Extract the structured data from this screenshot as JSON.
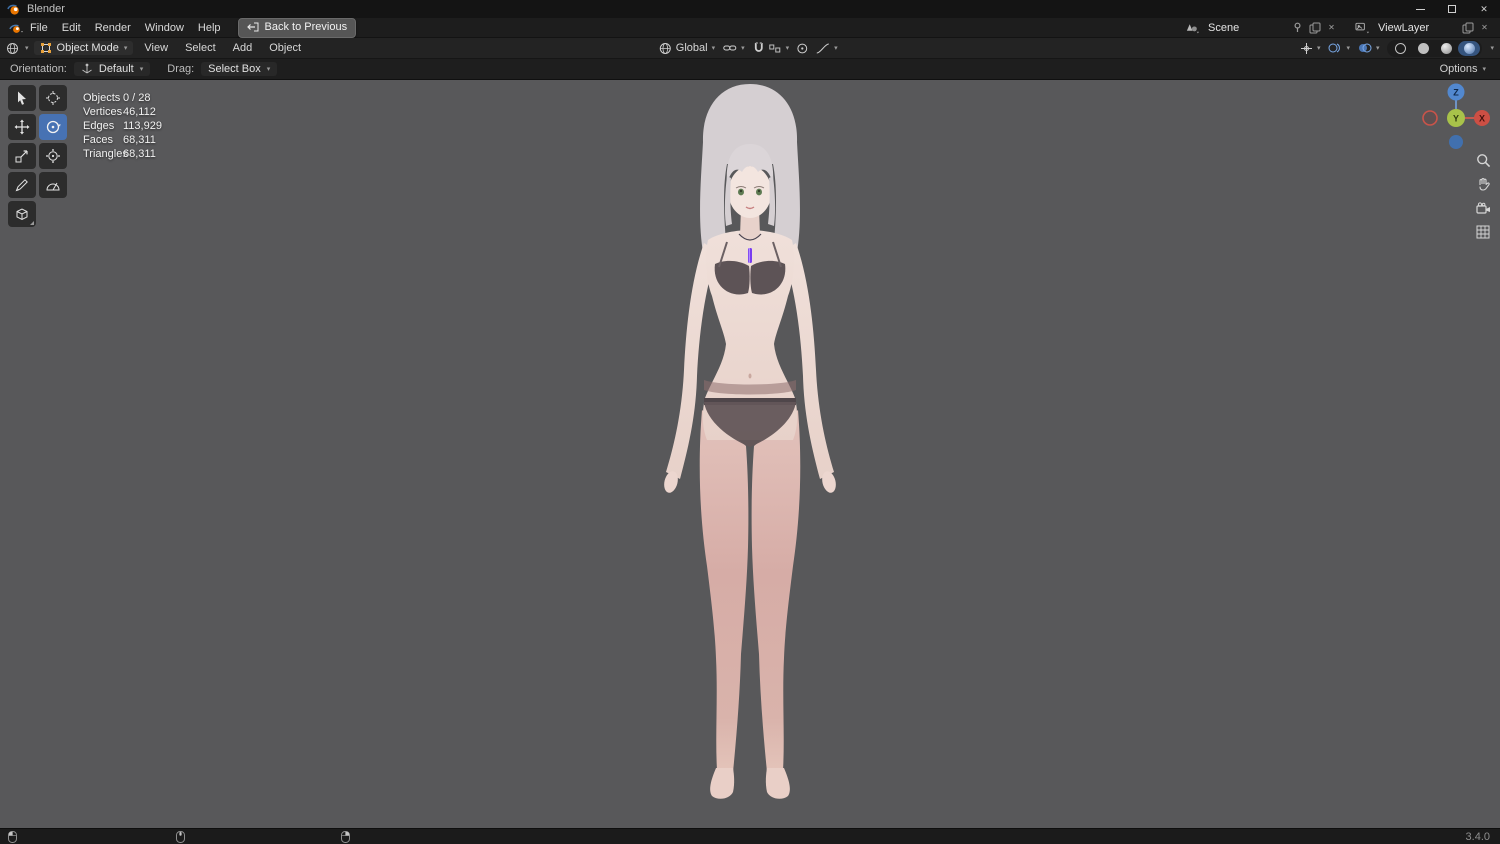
{
  "window": {
    "title": "Blender"
  },
  "topbar": {
    "menus": [
      "File",
      "Edit",
      "Render",
      "Window",
      "Help"
    ],
    "back_button": "Back to Previous",
    "scene": {
      "value": "Scene"
    },
    "view_layer": {
      "value": "ViewLayer"
    }
  },
  "viewport_header": {
    "mode": "Object Mode",
    "menus": [
      "View",
      "Select",
      "Add",
      "Object"
    ],
    "orientation": "Global",
    "options": "Options"
  },
  "tool_settings": {
    "orientation_label": "Orientation:",
    "orientation_value": "Default",
    "drag_label": "Drag:",
    "drag_value": "Select Box"
  },
  "stats": {
    "rows": [
      {
        "label": "Objects",
        "value": "0 / 28"
      },
      {
        "label": "Vertices",
        "value": "46,112"
      },
      {
        "label": "Edges",
        "value": "113,929"
      },
      {
        "label": "Faces",
        "value": "68,311"
      },
      {
        "label": "Triangles",
        "value": "68,311"
      }
    ]
  },
  "gizmo": {
    "axes": {
      "x": "X",
      "y": "Y",
      "z": "Z"
    }
  },
  "status_bar": {
    "version": "3.4.0"
  },
  "icons": {
    "chevron_down": "▾",
    "close": "✕"
  },
  "colors": {
    "accent": "#4772b3",
    "axis_x": "#cc4f44",
    "axis_y": "#a8c24a",
    "axis_z": "#5288cf",
    "viewport_bg": "#58585a"
  }
}
